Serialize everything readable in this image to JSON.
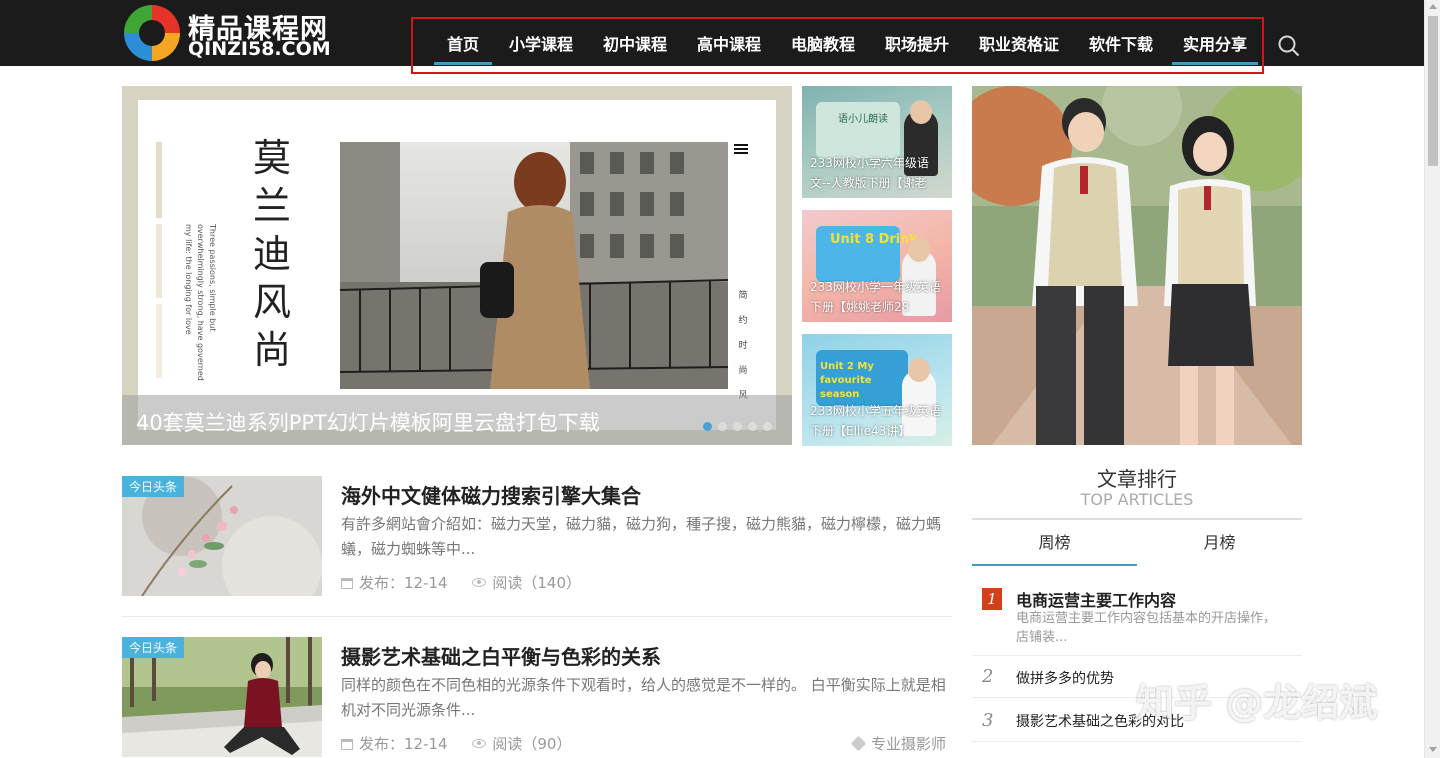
{
  "logo": {
    "title": "精品课程网",
    "subtitle": "QINZI58.COM"
  },
  "nav": {
    "items": [
      {
        "label": "首页"
      },
      {
        "label": "小学课程"
      },
      {
        "label": "初中课程"
      },
      {
        "label": "高中课程"
      },
      {
        "label": "电脑教程"
      },
      {
        "label": "职场提升"
      },
      {
        "label": "职业资格证"
      },
      {
        "label": "软件下载"
      },
      {
        "label": "实用分享"
      }
    ],
    "active_items": [
      "首页",
      "实用分享"
    ],
    "search_icon": "search-icon"
  },
  "slider": {
    "vertical_title": "莫\n兰\n迪\n风\n尚",
    "english_text": "Three passions, simple but overwhelmingly strong, have governed my life: the longing for love",
    "side_text": "简\n约\n时\n尚\n风",
    "caption": "40套莫兰迪系列PPT幻灯片模板阿里云盘打包下载",
    "dot_count": 5,
    "active_dot": 1
  },
  "thumbs": [
    {
      "caption": "233网校小学六年级语文--人教版下册【谢老",
      "board_text": "语小儿朗读"
    },
    {
      "caption": "233网校小学一年级英语下册【姚姚老师28",
      "board_text": "Unit 8 Drink"
    },
    {
      "caption": "233网校小学五年级英语下册【Ellie43讲】",
      "board_text": "Unit 2 My favourite season"
    }
  ],
  "articles": [
    {
      "tag": "今日头条",
      "title": "海外中文健体磁力搜索引擎大集合",
      "desc": "有許多網站會介紹如：磁力天堂，磁力貓，磁力狗，種子搜，磁力熊貓，磁力檸檬，磁力螞蟻，磁力蜘蛛等中...",
      "date": "发布：12-14",
      "reads": "阅读（140）",
      "category": ""
    },
    {
      "tag": "今日头条",
      "title": "摄影艺术基础之白平衡与色彩的关系",
      "desc": "同样的颜色在不同色相的光源条件下观看时，给人的感觉是不一样的。 白平衡实际上就是相机对不同光源条件...",
      "date": "发布：12-14",
      "reads": "阅读（90）",
      "category": "专业摄影师"
    }
  ],
  "ranking": {
    "title": "文章排行",
    "subtitle": "TOP ARTICLES",
    "tabs": [
      {
        "label": "周榜"
      },
      {
        "label": "月榜"
      }
    ],
    "active_tab": "周榜",
    "items": [
      {
        "num": "1",
        "name": "电商运营主要工作内容",
        "desc": "电商运营主要工作内容包括基本的开店操作，店铺装..."
      },
      {
        "num": "2",
        "name": "做拼多多的优势"
      },
      {
        "num": "3",
        "name": "摄影艺术基础之色彩的对比"
      }
    ]
  },
  "watermark": "知乎 @龙绍斌",
  "colors": {
    "header_bg": "#1b1b1b",
    "accent": "#3b9ec9",
    "highlight_box": "#d0171e",
    "tag_bg": "#4ab3dc",
    "rank_first": "#d2401b"
  }
}
